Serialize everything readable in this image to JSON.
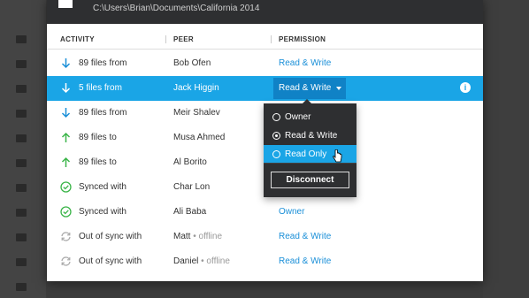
{
  "window": {
    "path": "C:\\Users\\Brian\\Documents\\California 2014"
  },
  "table": {
    "headers": [
      "ACTIVITY",
      "PEER",
      "PERMISSION"
    ],
    "rows": [
      {
        "icon": "arrow-down-icon",
        "activity": "89 files from",
        "peer": "Bob Ofen",
        "peer_status": "",
        "permission": "Read & Write"
      },
      {
        "icon": "arrow-down-icon",
        "activity": "5 files from",
        "peer": "Jack Higgin",
        "peer_status": "",
        "permission": "Read & Write",
        "selected": true
      },
      {
        "icon": "arrow-down-icon",
        "activity": "89 files from",
        "peer": "Meir Shalev",
        "peer_status": "",
        "permission": ""
      },
      {
        "icon": "arrow-up-icon",
        "activity": "89 files to",
        "peer": "Musa Ahmed",
        "peer_status": "",
        "permission": ""
      },
      {
        "icon": "arrow-up-icon",
        "activity": "89 files to",
        "peer": "Al Borito",
        "peer_status": "",
        "permission": ""
      },
      {
        "icon": "check-circle-icon",
        "activity": "Synced with",
        "peer": "Char Lon",
        "peer_status": "",
        "permission": ""
      },
      {
        "icon": "check-circle-icon",
        "activity": "Synced with",
        "peer": "Ali Baba",
        "peer_status": "",
        "permission": "Owner"
      },
      {
        "icon": "sync-icon",
        "activity": "Out of sync with",
        "peer": "Matt",
        "peer_status": " • offline",
        "permission": "Read & Write"
      },
      {
        "icon": "sync-icon",
        "activity": "Out of sync with",
        "peer": "Daniel",
        "peer_status": " • offline",
        "permission": "Read & Write"
      }
    ]
  },
  "dropdown": {
    "options": [
      "Owner",
      "Read & Write",
      "Read Only"
    ],
    "selected": "Read & Write",
    "hovered": "Read Only",
    "disconnect_label": "Disconnect"
  },
  "colors": {
    "accent": "#1aa5e6",
    "link": "#1a8fd8",
    "down_arrow": "#1a8fd8",
    "up_arrow": "#3cb54a",
    "check": "#3cb54a",
    "sync": "#aaaaaa"
  }
}
